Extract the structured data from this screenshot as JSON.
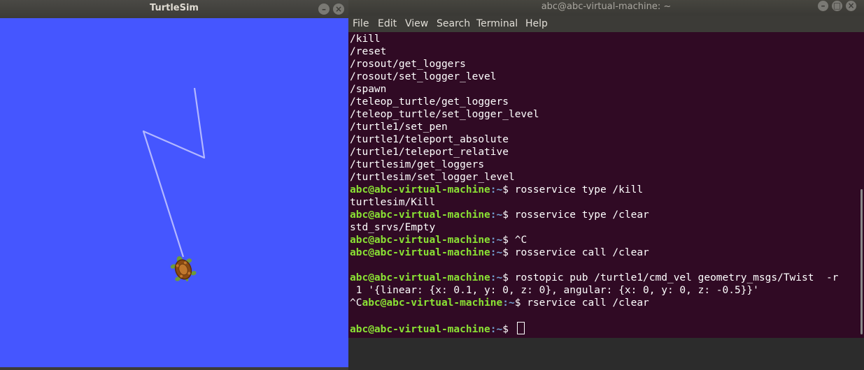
{
  "turtlesim": {
    "title": "TurtleSim",
    "buttons": {
      "minimize": "–",
      "close": "×"
    },
    "colors": {
      "background": "#4556ff",
      "pen": "#b3b8ff"
    }
  },
  "terminal": {
    "title": "abc@abc-virtual-machine: ~",
    "buttons": {
      "minimize": "–",
      "maximize": "□",
      "close": "×"
    },
    "menu": [
      "File",
      "Edit",
      "View",
      "Search",
      "Terminal",
      "Help"
    ],
    "colors": {
      "background": "#300a24",
      "user": "#8ae234",
      "path": "#729fcf"
    },
    "lines": [
      {
        "text": "/kill"
      },
      {
        "text": "/reset"
      },
      {
        "text": "/rosout/get_loggers"
      },
      {
        "text": "/rosout/set_logger_level"
      },
      {
        "text": "/spawn"
      },
      {
        "text": "/teleop_turtle/get_loggers"
      },
      {
        "text": "/teleop_turtle/set_logger_level"
      },
      {
        "text": "/turtle1/set_pen"
      },
      {
        "text": "/turtle1/teleport_absolute"
      },
      {
        "text": "/turtle1/teleport_relative"
      },
      {
        "text": "/turtlesim/get_loggers"
      },
      {
        "text": "/turtlesim/set_logger_level"
      },
      {
        "pre": "",
        "user": "abc@abc-virtual-machine",
        "path": ":~",
        "text": "$ rosservice type /kill"
      },
      {
        "text": "turtlesim/Kill"
      },
      {
        "pre": "",
        "user": "abc@abc-virtual-machine",
        "path": ":~",
        "text": "$ rosservice type /clear"
      },
      {
        "text": "std_srvs/Empty"
      },
      {
        "pre": "",
        "user": "abc@abc-virtual-machine",
        "path": ":~",
        "text": "$ ^C"
      },
      {
        "pre": "",
        "user": "abc@abc-virtual-machine",
        "path": ":~",
        "text": "$ rosservice call /clear"
      },
      {
        "text": ""
      },
      {
        "pre": "",
        "user": "abc@abc-virtual-machine",
        "path": ":~",
        "text": "$ rostopic pub /turtle1/cmd_vel geometry_msgs/Twist  -r"
      },
      {
        "text": " 1 '{linear: {x: 0.1, y: 0, z: 0}, angular: {x: 0, y: 0, z: -0.5}}'"
      },
      {
        "pre": "^C",
        "user": "abc@abc-virtual-machine",
        "path": ":~",
        "text": "$ rservice call /clear"
      },
      {
        "text": ""
      },
      {
        "pre": "",
        "user": "abc@abc-virtual-machine",
        "path": ":~",
        "text": "$ ",
        "cursor": true
      }
    ]
  }
}
